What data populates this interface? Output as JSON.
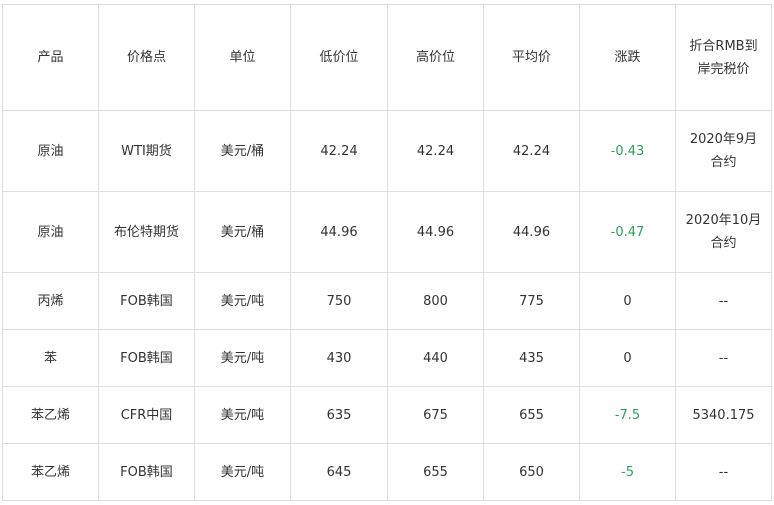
{
  "table": {
    "headers": [
      "产品",
      "价格点",
      "单位",
      "低价位",
      "高价位",
      "平均价",
      "涨跌",
      "折合RMB到岸完税价"
    ],
    "rows": [
      {
        "product": "原油",
        "price_point": "WTI期货",
        "unit": "美元/桶",
        "low": "42.24",
        "high": "42.24",
        "avg": "42.24",
        "change": "-0.43",
        "change_color": "#2ea15b",
        "rmb": "2020年9月合约"
      },
      {
        "product": "原油",
        "price_point": "布伦特期货",
        "unit": "美元/桶",
        "low": "44.96",
        "high": "44.96",
        "avg": "44.96",
        "change": "-0.47",
        "change_color": "#2ea15b",
        "rmb": "2020年10月合约"
      },
      {
        "product": "丙烯",
        "price_point": "FOB韩国",
        "unit": "美元/吨",
        "low": "750",
        "high": "800",
        "avg": "775",
        "change": "0",
        "change_color": "#333333",
        "rmb": "--"
      },
      {
        "product": "苯",
        "price_point": "FOB韩国",
        "unit": "美元/吨",
        "low": "430",
        "high": "440",
        "avg": "435",
        "change": "0",
        "change_color": "#333333",
        "rmb": "--"
      },
      {
        "product": "苯乙烯",
        "price_point": "CFR中国",
        "unit": "美元/吨",
        "low": "635",
        "high": "675",
        "avg": "655",
        "change": "-7.5",
        "change_color": "#2ea15b",
        "rmb": "5340.175"
      },
      {
        "product": "苯乙烯",
        "price_point": "FOB韩国",
        "unit": "美元/吨",
        "low": "645",
        "high": "655",
        "avg": "650",
        "change": "-5",
        "change_color": "#2ea15b",
        "rmb": "--"
      }
    ]
  }
}
